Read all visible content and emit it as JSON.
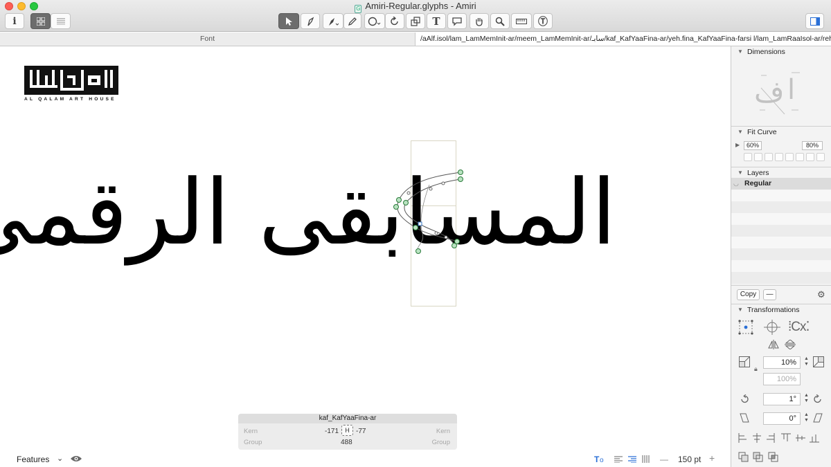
{
  "window": {
    "title": "Amiri-Regular.glyphs - Amiri"
  },
  "tabs": {
    "font_tab": "Font",
    "edit_text": "/aAlf.isol/lam_LamMemInit-ar/meem_LamMemInit-ar/سابـ/kaf_KafYaaFina-ar/yeh.fina_KafYaaFina-farsi  l/lam_LamRaaIsol-ar/reh_..."
  },
  "toolbar": {
    "info_icon": "info-icon",
    "grid_view_icon": "grid-view-icon",
    "list_view_icon": "list-view-icon",
    "select_tool_icon": "select-arrow-icon",
    "draw_tool_icon": "draw-tool-icon",
    "pen_tool_icon": "pen-tool-icon",
    "pencil_tool_icon": "pencil-icon",
    "shape_tool_icon": "ellipse-icon",
    "rotate_tool_icon": "rotate-icon",
    "scale_tool_icon": "scale-icon",
    "text_tool_icon": "text-tool-icon",
    "annotation_tool_icon": "speech-bubble-icon",
    "hand_tool_icon": "hand-icon",
    "zoom_tool_icon": "magnifier-icon",
    "measure_tool_icon": "ruler-icon",
    "metrics_tool_icon": "metrics-text-icon",
    "sidebar_toggle_icon": "sidebar-toggle-icon"
  },
  "canvas": {
    "logo_tagline": "AL QALAM ART HOUSE",
    "arabic_text": "المسابقى الرقمى"
  },
  "kern_panel": {
    "glyph_name": "kaf_KafYaaFina-ar",
    "left_kern_label": "Kern",
    "left_group_label": "Group",
    "right_kern_label": "Kern",
    "right_group_label": "Group",
    "lsb": "-171",
    "rsb": "-77",
    "width": "488"
  },
  "bottom_bar": {
    "features_label": "Features",
    "zoom_value": "150 pt",
    "minus_label": "—",
    "plus_label": "+"
  },
  "sidebar": {
    "dimensions_title": "Dimensions",
    "fit_curve_title": "Fit Curve",
    "fit_curve_min": "60%",
    "fit_curve_max": "80%",
    "layers_title": "Layers",
    "layer_active": "Regular",
    "copy_button": "Copy",
    "dash_button": "—",
    "transformations_title": "Transformations",
    "scale_value": "10%",
    "scale_value_2": "100%",
    "rotate_value": "1°",
    "slant_value": "0°"
  }
}
